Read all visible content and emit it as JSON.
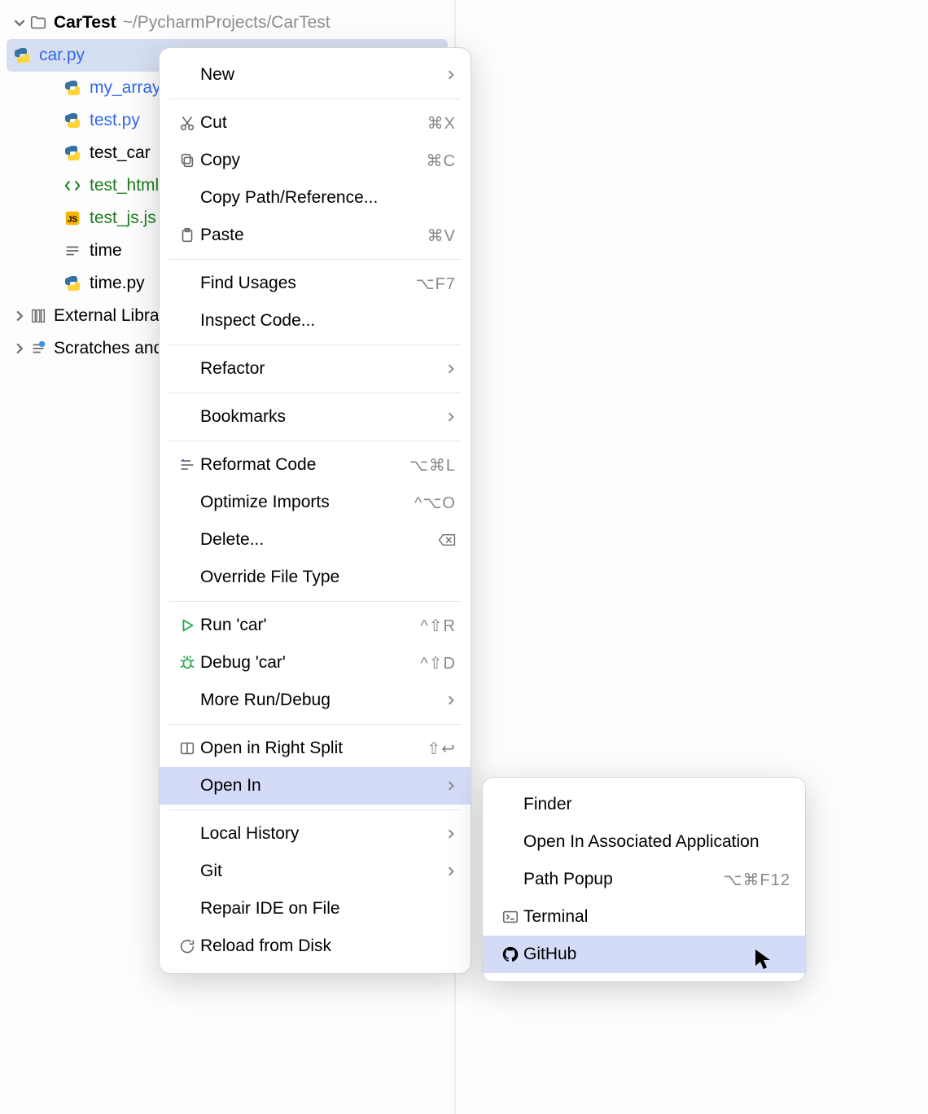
{
  "tree": {
    "root": {
      "name": "CarTest",
      "path": "~/PycharmProjects/CarTest"
    },
    "files": [
      {
        "name": "car.py",
        "kind": "py",
        "selected": true
      },
      {
        "name": "my_array",
        "kind": "py"
      },
      {
        "name": "test.py",
        "kind": "py"
      },
      {
        "name": "test_car",
        "kind": "py",
        "color": "black"
      },
      {
        "name": "test_html",
        "kind": "html",
        "color": "green"
      },
      {
        "name": "test_js.js",
        "kind": "js",
        "color": "green"
      },
      {
        "name": "time",
        "kind": "text",
        "color": "black"
      },
      {
        "name": "time.py",
        "kind": "py",
        "color": "black"
      }
    ],
    "external": "External Libraries",
    "scratches": "Scratches and Consoles"
  },
  "context_menu": {
    "items": [
      {
        "label": "New",
        "submenu": true
      },
      {
        "sep": true
      },
      {
        "label": "Cut",
        "icon": "cut",
        "shortcut": "⌘X"
      },
      {
        "label": "Copy",
        "icon": "copy",
        "shortcut": "⌘C"
      },
      {
        "label": "Copy Path/Reference..."
      },
      {
        "label": "Paste",
        "icon": "paste",
        "shortcut": "⌘V"
      },
      {
        "sep": true
      },
      {
        "label": "Find Usages",
        "shortcut": "⌥F7"
      },
      {
        "label": "Inspect Code..."
      },
      {
        "sep": true
      },
      {
        "label": "Refactor",
        "submenu": true
      },
      {
        "sep": true
      },
      {
        "label": "Bookmarks",
        "submenu": true
      },
      {
        "sep": true
      },
      {
        "label": "Reformat Code",
        "icon": "reformat",
        "shortcut": "⌥⌘L"
      },
      {
        "label": "Optimize Imports",
        "shortcut": "^⌥O"
      },
      {
        "label": "Delete...",
        "icon_right": "delete"
      },
      {
        "label": "Override File Type"
      },
      {
        "sep": true
      },
      {
        "label": "Run 'car'",
        "icon": "run",
        "shortcut": "^⇧R"
      },
      {
        "label": "Debug 'car'",
        "icon": "debug",
        "shortcut": "^⇧D"
      },
      {
        "label": "More Run/Debug",
        "submenu": true
      },
      {
        "sep": true
      },
      {
        "label": "Open in Right Split",
        "icon": "split",
        "shortcut": "⇧↩"
      },
      {
        "label": "Open In",
        "submenu": true,
        "highlight": true
      },
      {
        "sep": true
      },
      {
        "label": "Local History",
        "submenu": true
      },
      {
        "label": "Git",
        "submenu": true
      },
      {
        "label": "Repair IDE on File"
      },
      {
        "label": "Reload from Disk",
        "icon": "reload"
      }
    ]
  },
  "open_in_submenu": {
    "items": [
      {
        "label": "Finder"
      },
      {
        "label": "Open In Associated Application"
      },
      {
        "label": "Path Popup",
        "shortcut": "⌥⌘F12"
      },
      {
        "label": "Terminal",
        "icon": "terminal"
      },
      {
        "label": "GitHub",
        "icon": "github",
        "highlight": true
      }
    ]
  }
}
